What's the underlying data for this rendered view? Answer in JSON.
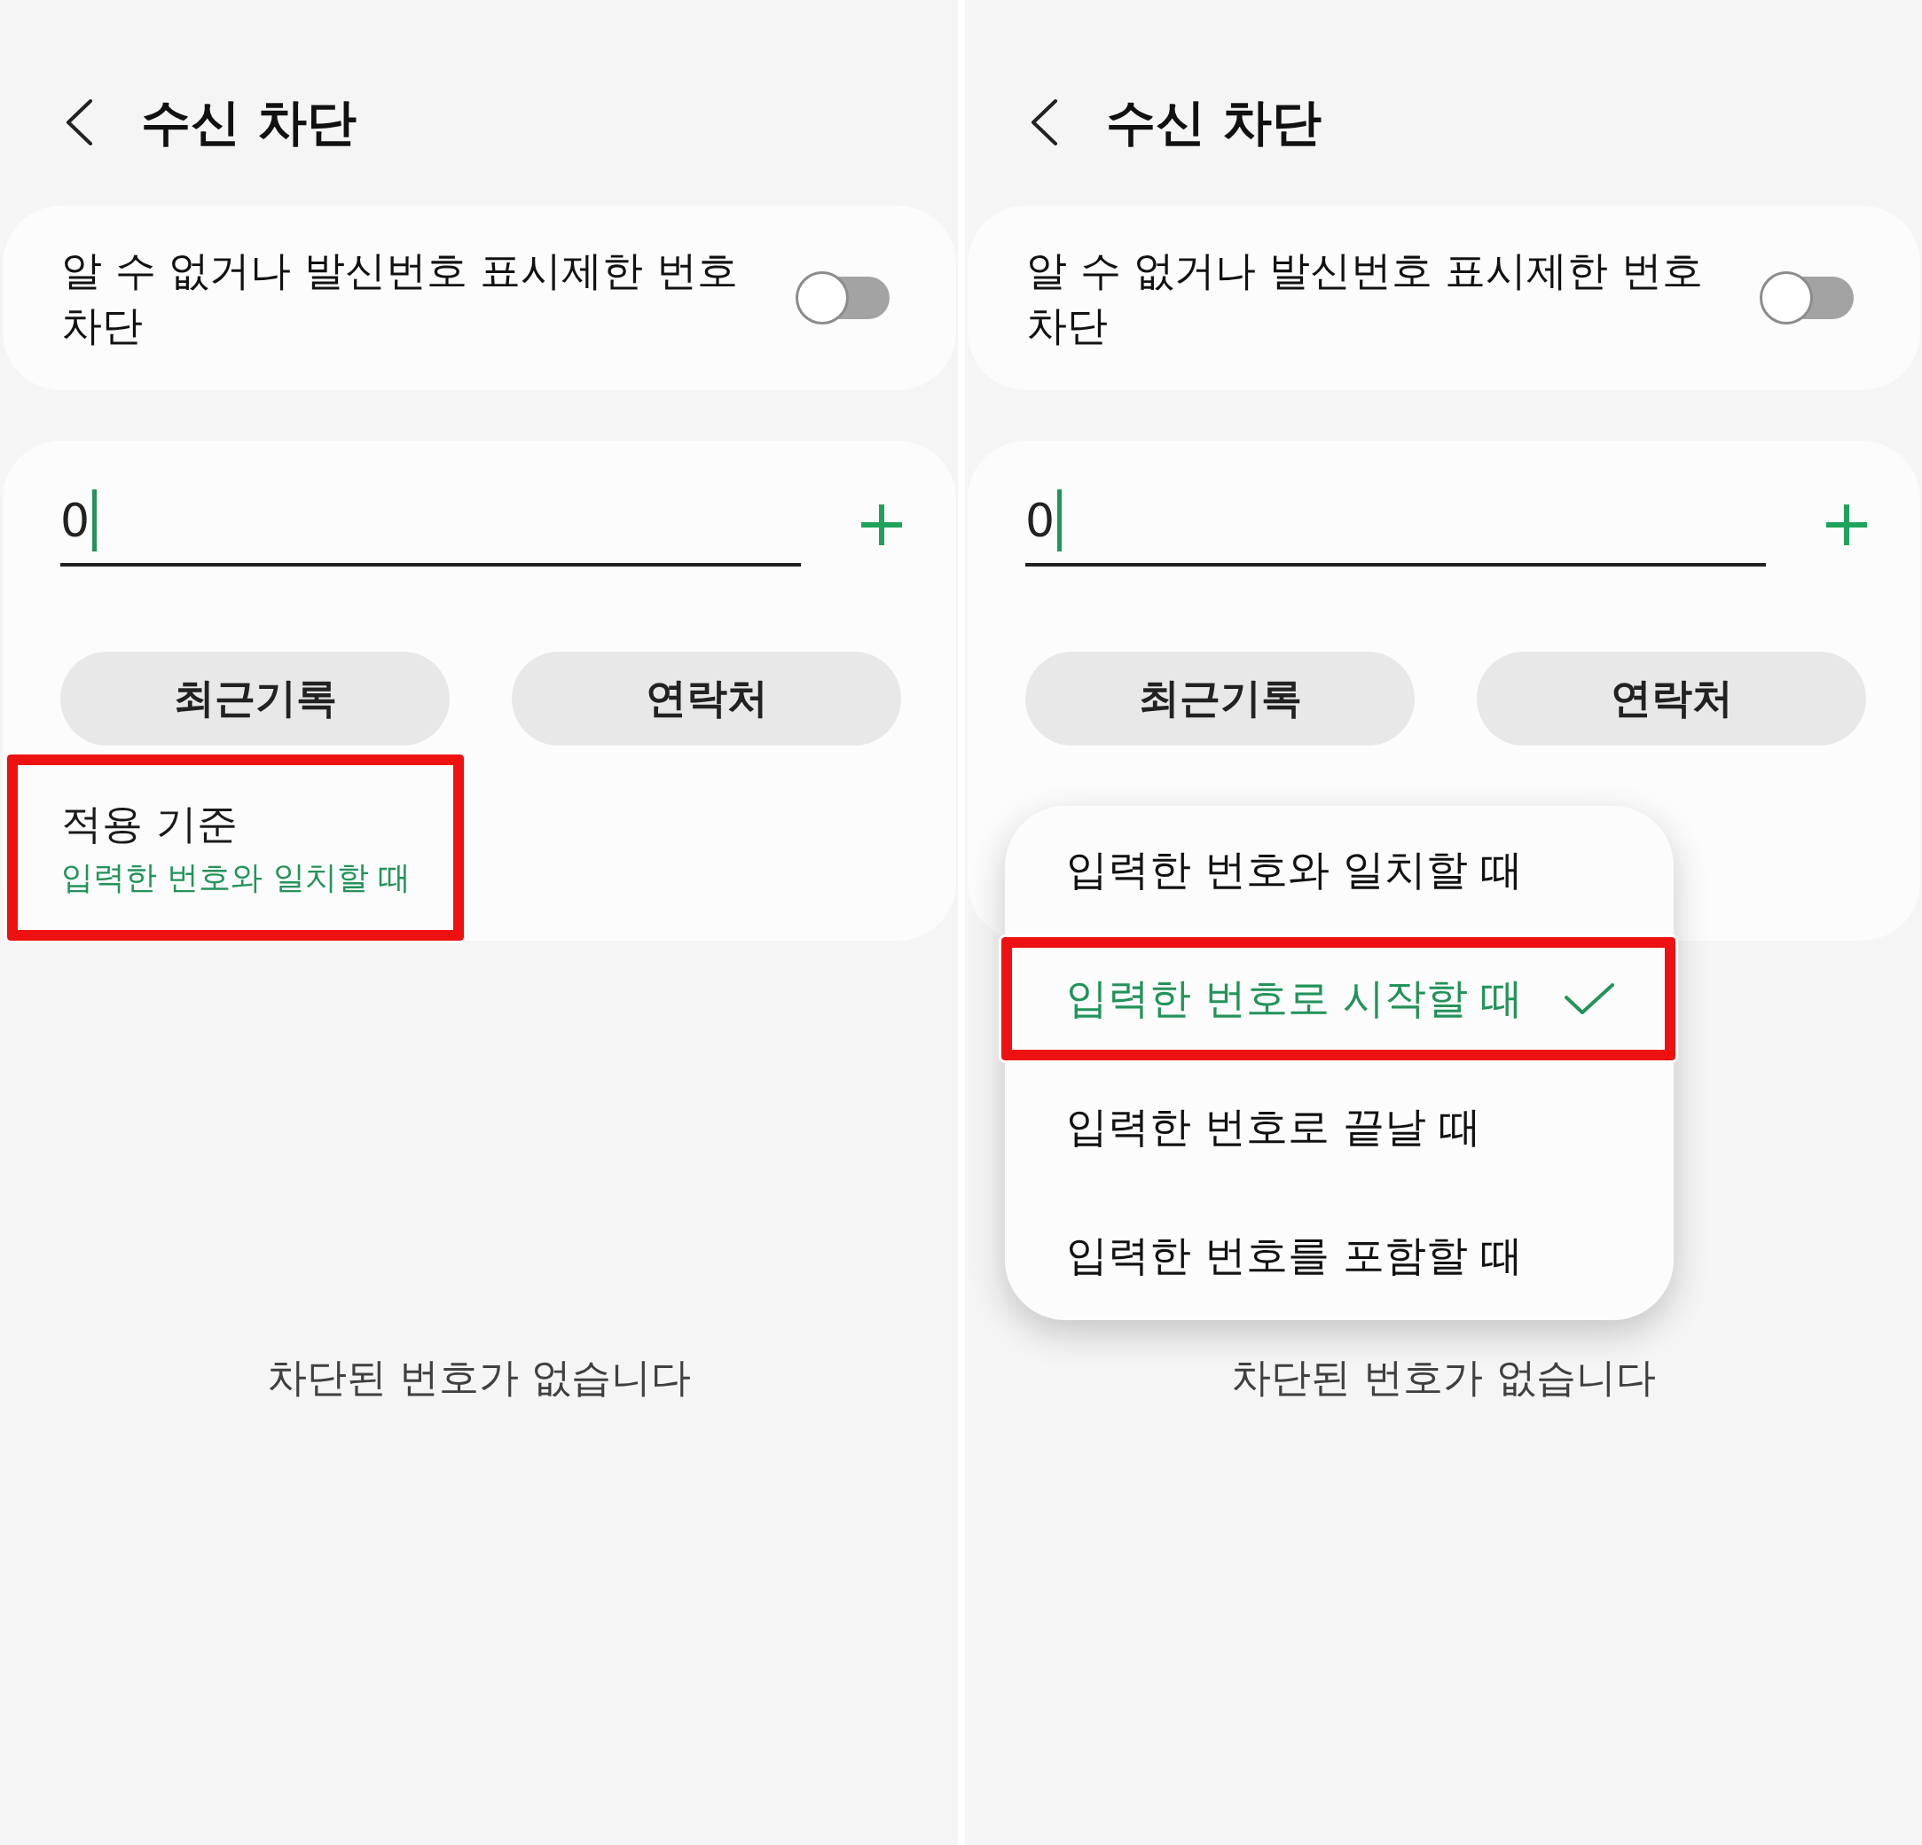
{
  "panels": [
    {
      "header": {
        "title": "수신 차단"
      },
      "unknown_number_toggle": {
        "label": "알 수 없거나 발신번호 표시제한 번호 차단",
        "on": false
      },
      "number_input": {
        "value": "0",
        "focused": true
      },
      "buttons": [
        "최근기록",
        "연락처"
      ],
      "criterion": {
        "title": "적용 기준",
        "value": "입력한 번호와 일치할 때",
        "highlighted": true
      },
      "empty_message": "차단된 번호가 없습니다"
    },
    {
      "header": {
        "title": "수신 차단"
      },
      "unknown_number_toggle": {
        "label": "알 수 없거나 발신번호 표시제한 번호 차단",
        "on": false
      },
      "number_input": {
        "value": "0",
        "focused": true
      },
      "buttons": [
        "최근기록",
        "연락처"
      ],
      "criterion_menu": {
        "options": [
          {
            "label": "입력한 번호와 일치할 때",
            "selected": false,
            "highlighted": false
          },
          {
            "label": "입력한 번호로 시작할 때",
            "selected": true,
            "highlighted": true
          },
          {
            "label": "입력한 번호로 끝날 때",
            "selected": false,
            "highlighted": false
          },
          {
            "label": "입력한 번호를 포함할 때",
            "selected": false,
            "highlighted": false
          }
        ]
      },
      "empty_message": "차단된 번호가 없습니다"
    }
  ]
}
